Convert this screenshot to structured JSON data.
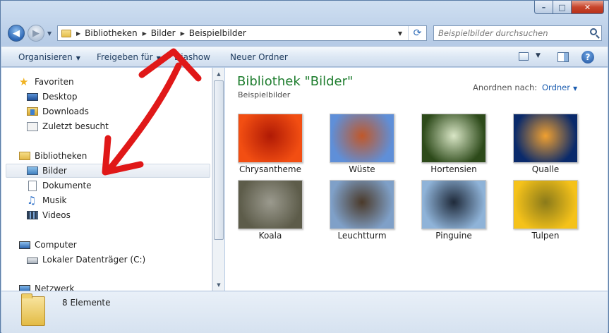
{
  "window": {
    "buttons": {
      "minimize": "–",
      "maximize": "□",
      "close": "✕"
    }
  },
  "nav": {
    "back_glyph": "◀",
    "forward_glyph": "▶",
    "dropdown_glyph": "▼"
  },
  "address": {
    "crumbs": [
      "Bibliotheken",
      "Bilder",
      "Beispielbilder"
    ],
    "separator": "▶",
    "dropdown_glyph": "▼",
    "refresh_glyph": "⟳"
  },
  "search": {
    "placeholder": "Beispielbilder durchsuchen"
  },
  "toolbar": {
    "organize": "Organisieren",
    "share": "Freigeben für",
    "slideshow": "Diashow",
    "new_folder": "Neuer Ordner",
    "dropdown_glyph": "▼",
    "help": "?"
  },
  "sidebar": {
    "favorites": {
      "label": "Favoriten",
      "items": [
        "Desktop",
        "Downloads",
        "Zuletzt besucht"
      ]
    },
    "libraries": {
      "label": "Bibliotheken",
      "items": [
        "Bilder",
        "Dokumente",
        "Musik",
        "Videos"
      ]
    },
    "computer": {
      "label": "Computer",
      "items": [
        "Lokaler Datenträger (C:)"
      ]
    },
    "network": {
      "label": "Netzwerk"
    },
    "selected": "Bilder"
  },
  "main": {
    "title": "Bibliothek \"Bilder\"",
    "subtitle": "Beispielbilder",
    "arrange_label": "Anordnen nach:",
    "arrange_value": "Ordner",
    "items": [
      {
        "label": "Chrysantheme",
        "colors": [
          "#f24e12",
          "#b01a05"
        ]
      },
      {
        "label": "Wüste",
        "colors": [
          "#5f8fd8",
          "#c0582a"
        ]
      },
      {
        "label": "Hortensien",
        "colors": [
          "#2d4a1a",
          "#d9e6c6"
        ]
      },
      {
        "label": "Qualle",
        "colors": [
          "#0a2a6b",
          "#f0a030"
        ]
      },
      {
        "label": "Koala",
        "colors": [
          "#5d5c4a",
          "#9b9a8e"
        ]
      },
      {
        "label": "Leuchtturm",
        "colors": [
          "#7fa0c8",
          "#4b3a2a"
        ]
      },
      {
        "label": "Pinguine",
        "colors": [
          "#8fb3d8",
          "#1f2a3a"
        ]
      },
      {
        "label": "Tulpen",
        "colors": [
          "#f5c21a",
          "#8a7a1a"
        ]
      }
    ]
  },
  "status": {
    "count": "8 Elemente"
  },
  "colors": {
    "title_green": "#1e7d2e",
    "link_blue": "#1c5db0",
    "annotation_red": "#e01818"
  }
}
